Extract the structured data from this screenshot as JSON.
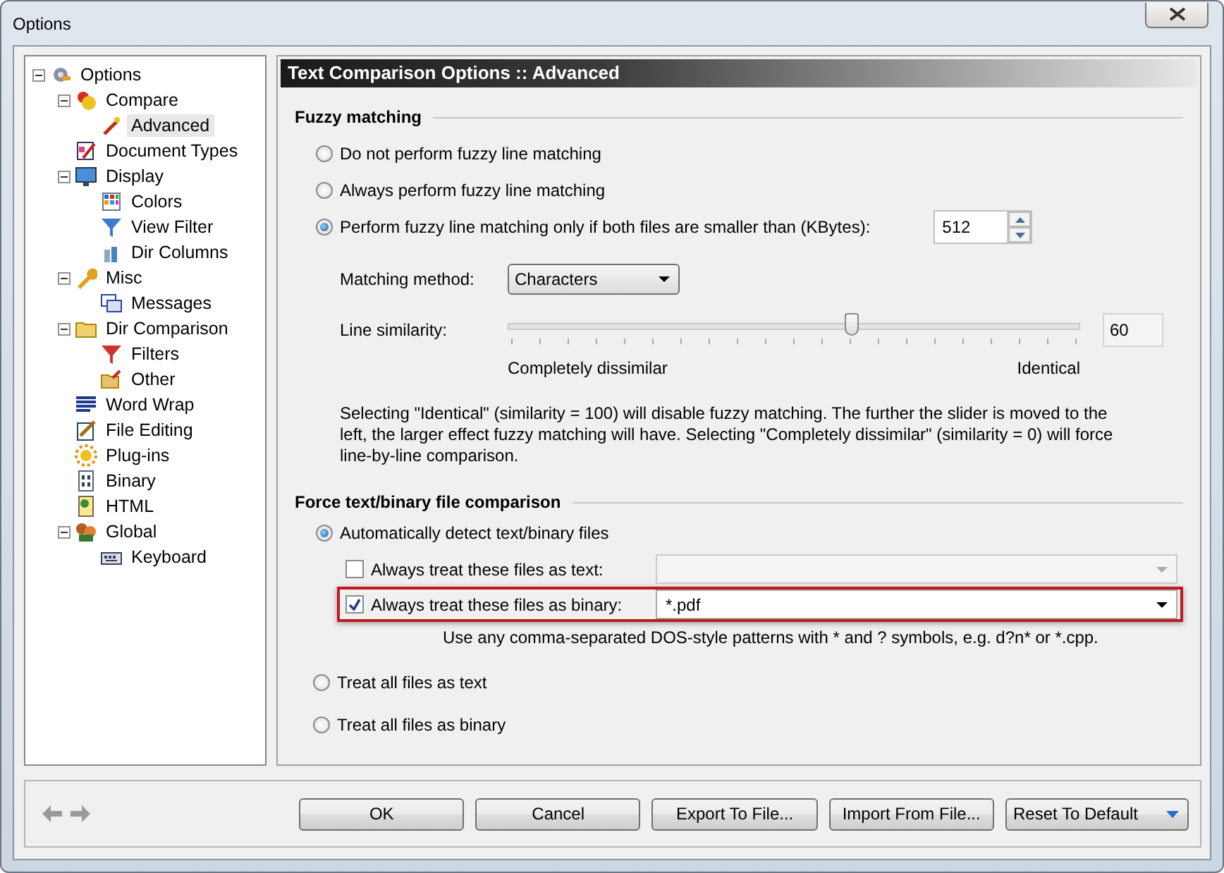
{
  "window": {
    "title": "Options"
  },
  "tree": [
    {
      "label": "Options",
      "expanded": true,
      "selected": false,
      "children": [
        {
          "label": "Compare",
          "expanded": true,
          "selected": false,
          "children": [
            {
              "label": "Advanced",
              "selected": true
            }
          ]
        },
        {
          "label": "Document Types",
          "selected": false
        },
        {
          "label": "Display",
          "expanded": true,
          "selected": false,
          "children": [
            {
              "label": "Colors",
              "selected": false
            },
            {
              "label": "View Filter",
              "selected": false
            },
            {
              "label": "Dir Columns",
              "selected": false
            }
          ]
        },
        {
          "label": "Misc",
          "expanded": true,
          "selected": false,
          "children": [
            {
              "label": "Messages",
              "selected": false
            }
          ]
        },
        {
          "label": "Dir Comparison",
          "expanded": true,
          "selected": false,
          "children": [
            {
              "label": "Filters",
              "selected": false
            },
            {
              "label": "Other",
              "selected": false
            }
          ]
        },
        {
          "label": "Word Wrap",
          "selected": false
        },
        {
          "label": "File Editing",
          "selected": false
        },
        {
          "label": "Plug-ins",
          "selected": false
        },
        {
          "label": "Binary",
          "selected": false
        },
        {
          "label": "HTML",
          "selected": false
        },
        {
          "label": "Global",
          "expanded": true,
          "selected": false,
          "children": [
            {
              "label": "Keyboard",
              "selected": false
            }
          ]
        }
      ]
    }
  ],
  "panel": {
    "header": "Text Comparison Options :: Advanced"
  },
  "fuzzy": {
    "heading": "Fuzzy matching",
    "options": [
      {
        "label": "Do not perform fuzzy line matching",
        "selected": false
      },
      {
        "label": "Always perform fuzzy line matching",
        "selected": false
      },
      {
        "label": "Perform fuzzy line matching only if both files are smaller than (KBytes):",
        "selected": true
      }
    ],
    "kbytes": "512",
    "method_label": "Matching method:",
    "method": "Characters",
    "similarity_label": "Line similarity:",
    "similarity": {
      "level": 0.6
    },
    "similarity_value": "60",
    "min_label": "Completely dissimilar",
    "max_label": "Identical",
    "note": "Selecting \"Identical\" (similarity = 100) will disable fuzzy matching. The further the slider is moved to the left, the larger effect fuzzy matching will have. Selecting \"Completely dissimilar\" (similarity = 0) will force line-by-line comparison."
  },
  "force": {
    "heading": "Force text/binary file comparison",
    "modes": [
      {
        "label": "Automatically detect text/binary files",
        "selected": true
      },
      {
        "label": "Treat all files as text",
        "selected": false
      },
      {
        "label": "Treat all files as binary",
        "selected": false
      }
    ],
    "lists": [
      {
        "label": "Always treat these files as text:",
        "checked": false,
        "disabled": true,
        "highlighted": false
      },
      {
        "label": "Always treat these files as binary:",
        "checked": true,
        "disabled": false,
        "highlighted": true,
        "value": "*.pdf"
      }
    ],
    "hint": "Use any comma-separated DOS-style patterns with * and ? symbols, e.g. d?n* or *.cpp."
  },
  "buttons": [
    {
      "label": "OK",
      "kind": "plain"
    },
    {
      "label": "Cancel",
      "kind": "plain"
    },
    {
      "label": "Export To File...",
      "kind": "plain"
    },
    {
      "label": "Import From File...",
      "kind": "plain"
    },
    {
      "label": "Reset To Default",
      "kind": "split"
    }
  ]
}
